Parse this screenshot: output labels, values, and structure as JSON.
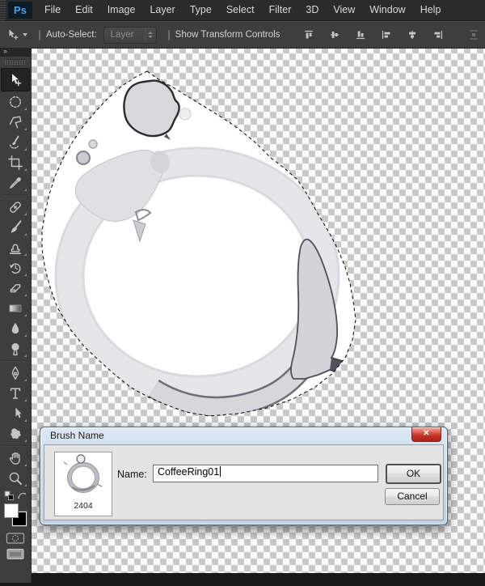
{
  "menu_bar": {
    "logo": "Ps",
    "items": [
      "File",
      "Edit",
      "Image",
      "Layer",
      "Type",
      "Select",
      "Filter",
      "3D",
      "View",
      "Window",
      "Help"
    ]
  },
  "options_bar": {
    "tool_icon": "move-tool-icon",
    "auto_select": {
      "label": "Auto-Select:",
      "checked": false
    },
    "layer_select": {
      "value": "Layer",
      "enabled": false
    },
    "show_transform": {
      "label": "Show Transform Controls",
      "checked": false
    },
    "align_icons": [
      "align-top-edges-icon",
      "align-vertical-centers-icon",
      "align-bottom-edges-icon",
      "align-left-edges-icon",
      "align-horizontal-centers-icon",
      "align-right-edges-icon"
    ],
    "distribute_icons": [
      "distribute-icon-1",
      "distribute-icon-2"
    ]
  },
  "toolbar": {
    "header_glyph": "»",
    "selected_tool": "move",
    "tools": [
      "move-tool-icon",
      "elliptical-marquee-icon",
      "polygonal-lasso-icon",
      "quick-selection-icon",
      "crop-icon",
      "eyedropper-icon",
      "healing-brush-icon",
      "brush-icon",
      "clone-stamp-icon",
      "history-brush-icon",
      "eraser-icon",
      "gradient-icon",
      "blur-icon",
      "dodge-icon",
      "pen-icon",
      "type-icon",
      "path-selection-icon",
      "custom-shape-icon",
      "hand-icon",
      "zoom-icon"
    ],
    "color_controls": [
      "swap-colors-icon",
      "foreground-color-white",
      "background-color-black",
      "quick-mask-icon",
      "screen-mode-icon"
    ]
  },
  "canvas": {
    "selection_marching_ants": true,
    "content_icon": "coffee-ring-stain"
  },
  "dialog": {
    "title": "Brush Name",
    "close_glyph": "✕",
    "preview": {
      "size_label": "2404",
      "icon": "brush-preview-coffee-ring"
    },
    "name_field": {
      "label": "Name:",
      "value": "CoffeeRing01"
    },
    "ok_label": "OK",
    "cancel_label": "Cancel"
  },
  "colors": {
    "menu_bg": "#2b2b2b",
    "panel_bg": "#3e3e3e",
    "logo_blue": "#45a5ec",
    "checker_gray": "#c9c9c9",
    "dialog_frame": "#cadbeb",
    "close_red": "#c03224",
    "client_gray": "#e3e3e3"
  }
}
